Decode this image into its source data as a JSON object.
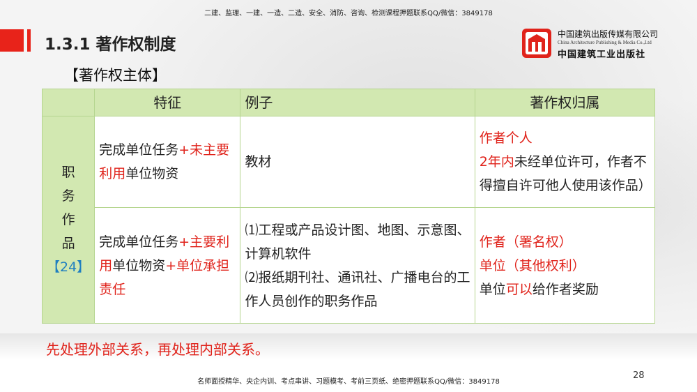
{
  "top_note": "二建、监理、一建、一造、二造、安全、消防、咨询、检测课程押题联系QQ/微信：3849178",
  "title": "1.3.1  著作权制度",
  "subtitle": "【著作权主体】",
  "logo": {
    "cn": "中国建筑出版传媒有限公司",
    "en": "China Architecture Publishing & Media Co.,Ltd",
    "calligraphy": "中国建筑工业出版社",
    "accent": "#e0231b"
  },
  "table": {
    "headers": [
      "",
      "特征",
      "例子",
      "著作权归属"
    ],
    "category": {
      "text": "职务作品",
      "number": "【24】"
    },
    "rows": [
      {
        "feature_a": "完成单位任务",
        "feature_b": "+未主要利用",
        "feature_c": "单位物资",
        "example": "教材",
        "owner_1": "作者个人",
        "owner_2_red": "2年内",
        "owner_2": "未经单位许可，作者不得擅自许可他人使用该作品）"
      },
      {
        "feature_a": "完成单位任务",
        "feature_b": "+主要利用",
        "feature_c": "单位物资",
        "feature_d": "+单位承担责任",
        "example_1": "⑴工程或产品设计图、地图、示意图、计算机软件",
        "example_2": "⑵报纸期刊社、通讯社、广播电台的工作人员创作的职务作品",
        "owner_1": "作者（署名权）",
        "owner_2": "单位（其他权利）",
        "owner_3a": "单位",
        "owner_3b": "可以",
        "owner_3c": "给作者奖励"
      }
    ]
  },
  "footer_note": "先处理外部关系，再处理内部关系。",
  "page_number": "28",
  "bottom_note": "名师面授精华、央企内训、考点串讲、习题模考、考前三页纸、绝密押题联系QQ/微信：3849178",
  "colors": {
    "header_green": "#d2e8b1",
    "border_green": "#b5d58f",
    "red": "#e0231b",
    "blue": "#1f7fc0"
  }
}
